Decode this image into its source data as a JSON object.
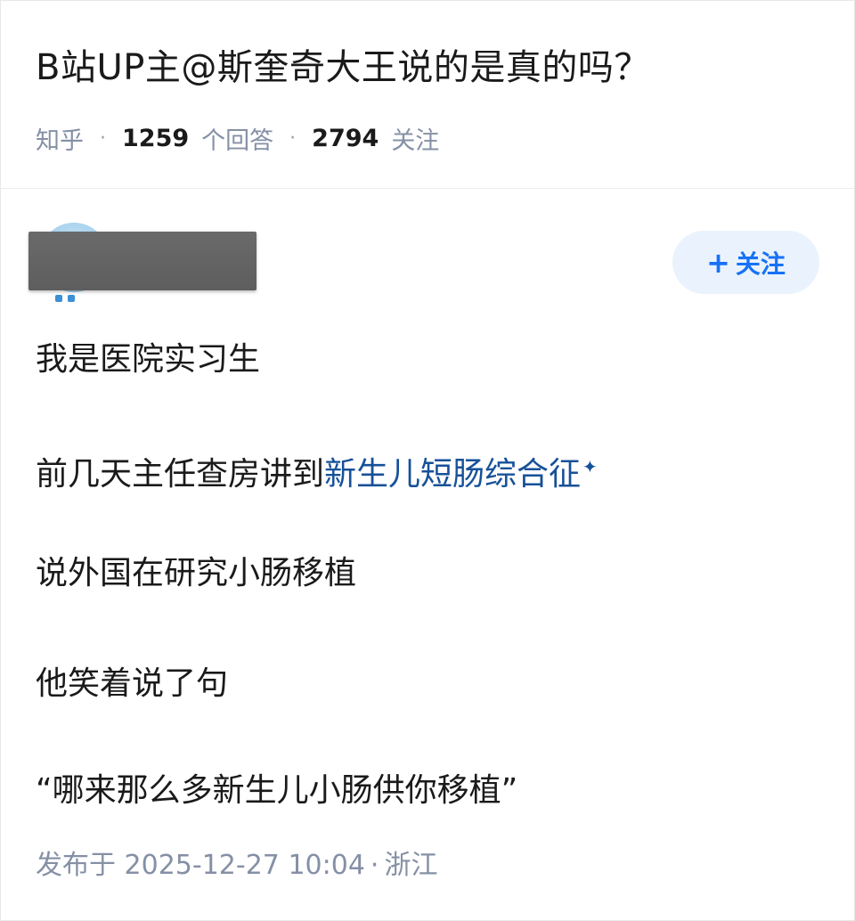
{
  "question": {
    "title": "B站UP主@斯奎奇大王说的是真的吗？",
    "source": "知乎",
    "answer_count": "1259",
    "answer_count_label": "个回答",
    "follower_count": "2794",
    "follower_label": "关注"
  },
  "author": {
    "follow_button_label": "关注",
    "follow_plus": "+"
  },
  "answer": {
    "paragraphs": [
      "我是医院实习生",
      "前几天主任查房讲到",
      "说外国在研究小肠移植",
      "他笑着说了句",
      "“哪来那么多新生儿小肠供你移植”"
    ],
    "linked_term": "新生儿短肠综合征",
    "link_icon": "✦"
  },
  "footer": {
    "published_label": "发布于",
    "date": "2025-12-27",
    "time": "10:04",
    "separator": "·",
    "location": "浙江"
  },
  "colors": {
    "accent": "#1772f6",
    "link": "#175199",
    "meta": "#8590a6",
    "follow_bg": "#eaf3fd",
    "redaction": "#5f5f5f"
  }
}
